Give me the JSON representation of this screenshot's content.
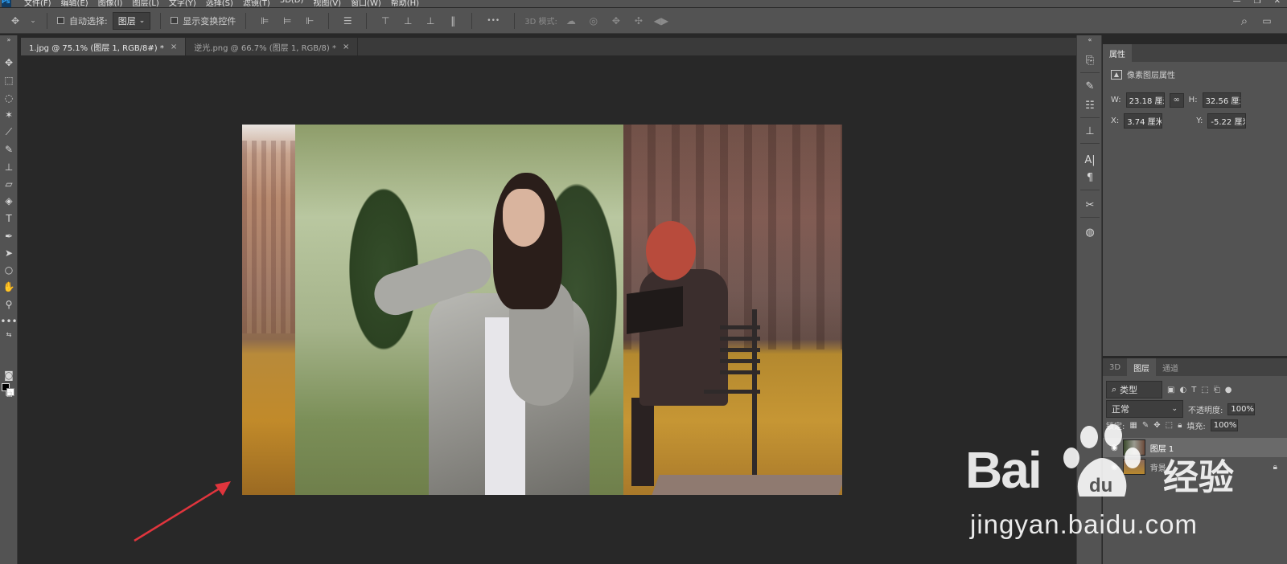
{
  "menubar": {
    "items": [
      "文件(F)",
      "编辑(E)",
      "图像(I)",
      "图层(L)",
      "文字(Y)",
      "选择(S)",
      "滤镜(T)",
      "3D(D)",
      "视图(V)",
      "窗口(W)",
      "帮助(H)"
    ],
    "window_buttons": [
      "—",
      "❐",
      "✕"
    ]
  },
  "options_bar": {
    "move_tool_icon": "✥",
    "auto_select_label": "自动选择:",
    "auto_select_target": "图层",
    "show_transform_label": "显示变换控件",
    "mode_3d_label": "3D 模式:",
    "more_label": "•••",
    "search_icon": "⌕",
    "workspace_icon": "▭"
  },
  "tabs": [
    {
      "label": "1.jpg @ 75.1% (图层 1, RGB/8#) *",
      "close": "×",
      "active": true
    },
    {
      "label": "逆光.png @ 66.7% (图层 1, RGB/8) *",
      "close": "×",
      "active": false
    }
  ],
  "properties_panel": {
    "tab_label": "属性",
    "section_title": "像素图层属性",
    "w_label": "W:",
    "w_value": "23.18 厘米",
    "h_label": "H:",
    "h_value": "32.56 厘米",
    "x_label": "X:",
    "x_value": "3.74 厘米",
    "y_label": "Y:",
    "y_value": "-5.22 厘米",
    "link_icon": "∞"
  },
  "layers_panel": {
    "tabs": [
      "3D",
      "图层",
      "通道"
    ],
    "active_tab": "图层",
    "filter_label": "类型",
    "blend_mode": "正常",
    "opacity_label": "不透明度:",
    "opacity_value": "100%",
    "lock_label": "锁定:",
    "fill_label": "填充:",
    "fill_value": "100%",
    "layers": [
      {
        "name": "图层 1",
        "selected": true
      },
      {
        "name": "背景",
        "selected": false
      }
    ]
  },
  "watermark": {
    "brand": "Bai",
    "brand_suffix": "经验",
    "url": "jingyan.baidu.com"
  },
  "colors": {
    "accent_arrow": "#e0353d",
    "panel_bg": "#535353",
    "canvas_bg": "#282828"
  }
}
